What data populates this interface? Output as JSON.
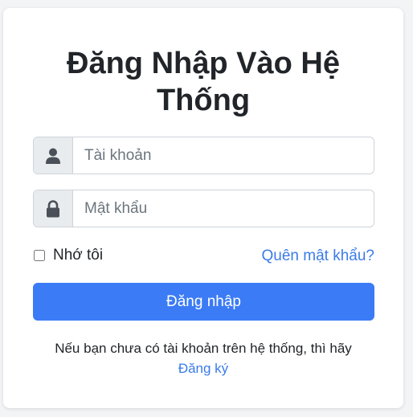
{
  "login": {
    "title": "Đăng Nhập Vào Hệ Thống",
    "username": {
      "placeholder": "Tài khoản",
      "value": ""
    },
    "password": {
      "placeholder": "Mật khẩu",
      "value": ""
    },
    "remember_label": "Nhớ tôi",
    "remember_checked": false,
    "forgot_label": "Quên mật khẩu?",
    "submit_label": "Đăng nhập",
    "signup_text": "Nếu bạn chưa có tài khoản trên hệ thống, thì hãy",
    "signup_link": "Đăng ký"
  },
  "icons": {
    "username": "user-icon",
    "password": "lock-icon"
  },
  "colors": {
    "accent": "#3b7bf5",
    "link": "#3b7be8",
    "addon_bg": "#e9ecef"
  }
}
